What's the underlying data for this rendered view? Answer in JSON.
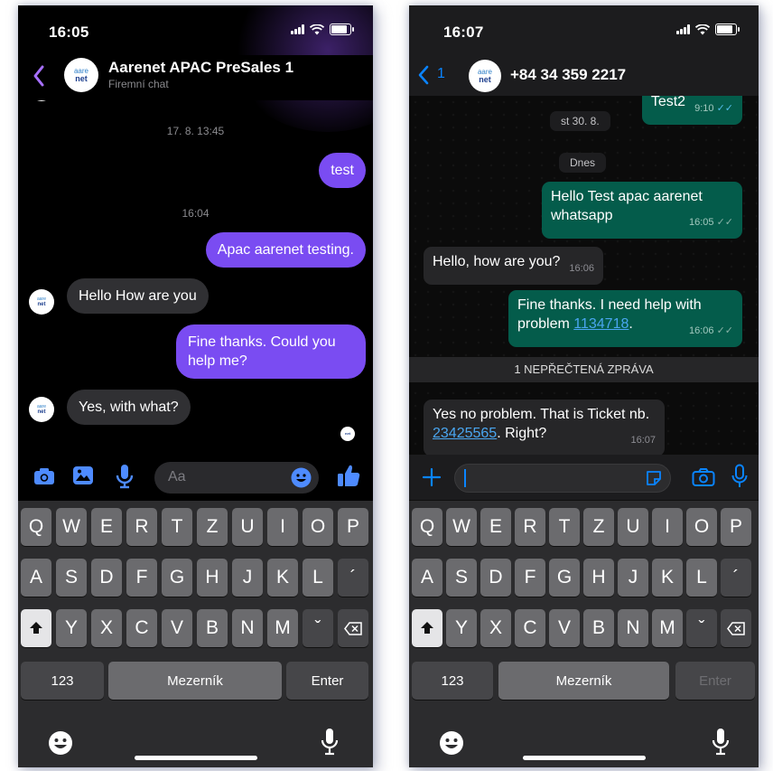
{
  "messenger": {
    "status_time": "16:05",
    "title": "Aarenet APAC PreSales 1",
    "subtitle": "Firemní chat",
    "avatar": {
      "line1": "aare",
      "line2": "net"
    },
    "messages": [
      {
        "type": "separator",
        "text": "17. 8. 13:45"
      },
      {
        "type": "out",
        "text": "test"
      },
      {
        "type": "separator",
        "text": "16:04"
      },
      {
        "type": "out",
        "text": "Apac aarenet testing."
      },
      {
        "type": "in",
        "text": "Hello How are you"
      },
      {
        "type": "out",
        "text": "Fine thanks. Could you help me?"
      },
      {
        "type": "in",
        "text": "Yes, with what?"
      }
    ],
    "composer_placeholder": "Aa",
    "icons": [
      "back-icon",
      "camera-icon",
      "gallery-icon",
      "microphone-icon",
      "emoji-icon",
      "thumbs-up-icon"
    ],
    "accent_color": "#7a4cf2"
  },
  "whatsapp": {
    "status_time": "16:07",
    "back_count": "1",
    "title": "+84 34 359 2217",
    "avatar": {
      "line1": "aare",
      "line2": "net"
    },
    "top_msg": {
      "text": "Test2",
      "time": "9:10"
    },
    "day_chip_1": "st 30. 8.",
    "day_chip_2": "Dnes",
    "messages": [
      {
        "type": "out",
        "text": "Hello Test apac aarenet whatsapp",
        "time": "16:05"
      },
      {
        "type": "in",
        "text": "Hello, how are you?",
        "time": "16:06"
      },
      {
        "type": "out",
        "text": "Fine thanks. I need help with problem",
        "link": "1134718",
        "suffix": ".",
        "time": "16:06"
      },
      {
        "type": "in",
        "text": "Yes no problem. That is Ticket nb.",
        "link": "23425565",
        "suffix": ". Right?",
        "time": "16:07"
      }
    ],
    "unread_banner": "1 NEPŘEČTENÁ ZPRÁVA",
    "icons": [
      "plus-icon",
      "sticker-icon",
      "camera-icon",
      "microphone-icon"
    ],
    "accent_color": "#0a84ff",
    "bubble_out_color": "#045c4b"
  },
  "keyboard": {
    "row1": [
      "Q",
      "W",
      "E",
      "R",
      "T",
      "Z",
      "U",
      "I",
      "O",
      "P"
    ],
    "row2": [
      "A",
      "S",
      "D",
      "F",
      "G",
      "H",
      "J",
      "K",
      "L",
      "´"
    ],
    "row3": [
      "Y",
      "X",
      "C",
      "V",
      "B",
      "N",
      "M",
      "ˇ"
    ],
    "numbers": "123",
    "space": "Mezerník",
    "enter": "Enter"
  }
}
